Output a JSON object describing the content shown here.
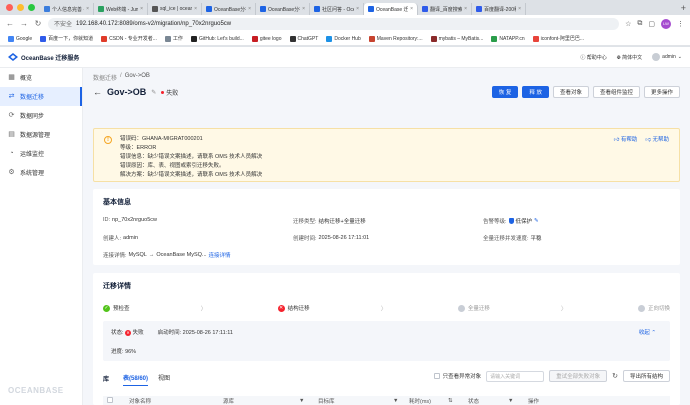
{
  "browser": {
    "tabs": [
      {
        "label": "个人信息完善 - Jira",
        "color": "#3b7ddd"
      },
      {
        "label": "Web终端 - Jump",
        "color": "#2aa160"
      },
      {
        "label": "sql_ice | ocean",
        "color": "#555555"
      },
      {
        "label": "OceanBase分布式",
        "color": "#1d63e4"
      },
      {
        "label": "OceanBase分布式",
        "color": "#1d63e4"
      },
      {
        "label": "社区问答 - Ocean",
        "color": "#1d63e4"
      },
      {
        "label": "OceanBase 迁移服",
        "color": "#1d63e4",
        "active": true
      },
      {
        "label": "翻译_百度搜索",
        "color": "#2f5bea"
      },
      {
        "label": "百度翻译-200种",
        "color": "#2f5bea"
      }
    ],
    "url_prefix": "不安全",
    "url": "192.168.40.172:8089/oms-v2/migration/np_70x2nrguo5cw",
    "profile_initials": "LW",
    "bookmarks": [
      {
        "label": "Google",
        "color": "#4285f4"
      },
      {
        "label": "百度一下，你就知道",
        "color": "#2f5bea"
      },
      {
        "label": "CSDN - 专业开发者...",
        "color": "#e03b2a"
      },
      {
        "label": "工作",
        "color": "#7a8794"
      },
      {
        "label": "GitHub: Let's build...",
        "color": "#222222"
      },
      {
        "label": "gitee logo",
        "color": "#c71d23"
      },
      {
        "label": "ChatGPT",
        "color": "#333333"
      },
      {
        "label": "Docker Hub",
        "color": "#1d91e6"
      },
      {
        "label": "Maven Repository:...",
        "color": "#c7432f"
      },
      {
        "label": "mybatis – MyBatis...",
        "color": "#8a2a2a"
      },
      {
        "label": "NATAPP.cn",
        "color": "#2a9d4a"
      },
      {
        "label": "iconfont-阿里巴巴...",
        "color": "#e8443a"
      }
    ]
  },
  "app": {
    "brand": "OceanBase 迁移服务",
    "top_help": "帮助中心",
    "top_lang": "简体中文",
    "top_user": "admin"
  },
  "sidebar": {
    "items": [
      {
        "label": "概览",
        "icon": "overview-icon"
      },
      {
        "label": "数据迁移",
        "icon": "migration-icon",
        "active": true
      },
      {
        "label": "数据同步",
        "icon": "sync-icon"
      },
      {
        "label": "数据源管理",
        "icon": "datasource-icon"
      },
      {
        "label": "运维监控",
        "icon": "monitor-icon"
      },
      {
        "label": "系统管理",
        "icon": "system-icon"
      }
    ],
    "watermark": "OCEANBASE"
  },
  "page": {
    "breadcrumb": [
      "数据迁移",
      "/",
      "Gov->OB"
    ],
    "title": "Gov->OB",
    "status": "失败",
    "actions": {
      "resume": "恢 复",
      "release": "释 放",
      "view_objects": "查看对象",
      "view_monitor": "查看组件监控",
      "more": "更多操作"
    }
  },
  "alert": {
    "lines": [
      "错误码：GHANA-MIGRAT000201",
      "等级：ERROR",
      "错误信息：缺少错误文案描述，请联系 OMS 技术人员解决",
      "错误原因：库、表、视图或索引迁移失败。",
      "解决方案：缺少错误文案描述，请联系 OMS 技术人员解决"
    ],
    "helpful": "有帮助",
    "unhelpful": "无帮助"
  },
  "basic": {
    "title": "基本信息",
    "id_label": "ID:",
    "id_value": "np_70x2nrguo5cw",
    "type_label": "迁移类型:",
    "type_value": "结构迁移+全量迁移",
    "alert_label": "告警等级:",
    "alert_value": "低保护",
    "creator_label": "创建人:",
    "creator_value": "admin",
    "created_label": "创建时间:",
    "created_value": "2025-08-26 17:11:01",
    "concurrency_label": "全量迁移并发速度:",
    "concurrency_value": "平稳",
    "conn_label": "连接详情:",
    "conn_source": "MySQL",
    "conn_arrow": "→",
    "conn_target": "OceanBase MySQ...",
    "conn_link": "连接详情"
  },
  "migration": {
    "title": "迁移详情",
    "steps": [
      {
        "label": "预检查",
        "state": "ok"
      },
      {
        "label": "结构迁移",
        "state": "err"
      },
      {
        "label": "全量迁移",
        "state": "wait"
      },
      {
        "label": "正向切换",
        "state": "wait"
      }
    ],
    "status_label": "状态:",
    "status_value": "失败",
    "start_label": "启动时间:",
    "start_value": "2025-08-26 17:11:11",
    "collapse": "收起",
    "progress_label": "进度:",
    "progress_value": "96%",
    "lib_label": "库",
    "tab_table": "表(58/60)",
    "tab_view": "视图",
    "only_abnormal": "只查看异常对象",
    "search_placeholder": "请输入关键词",
    "batch_btn": "重试全部失败对象",
    "export_btn": "导出所有结构",
    "columns": [
      "对象名称",
      "源库",
      "目标库",
      "耗时(ms)",
      "状态",
      "操作"
    ]
  }
}
